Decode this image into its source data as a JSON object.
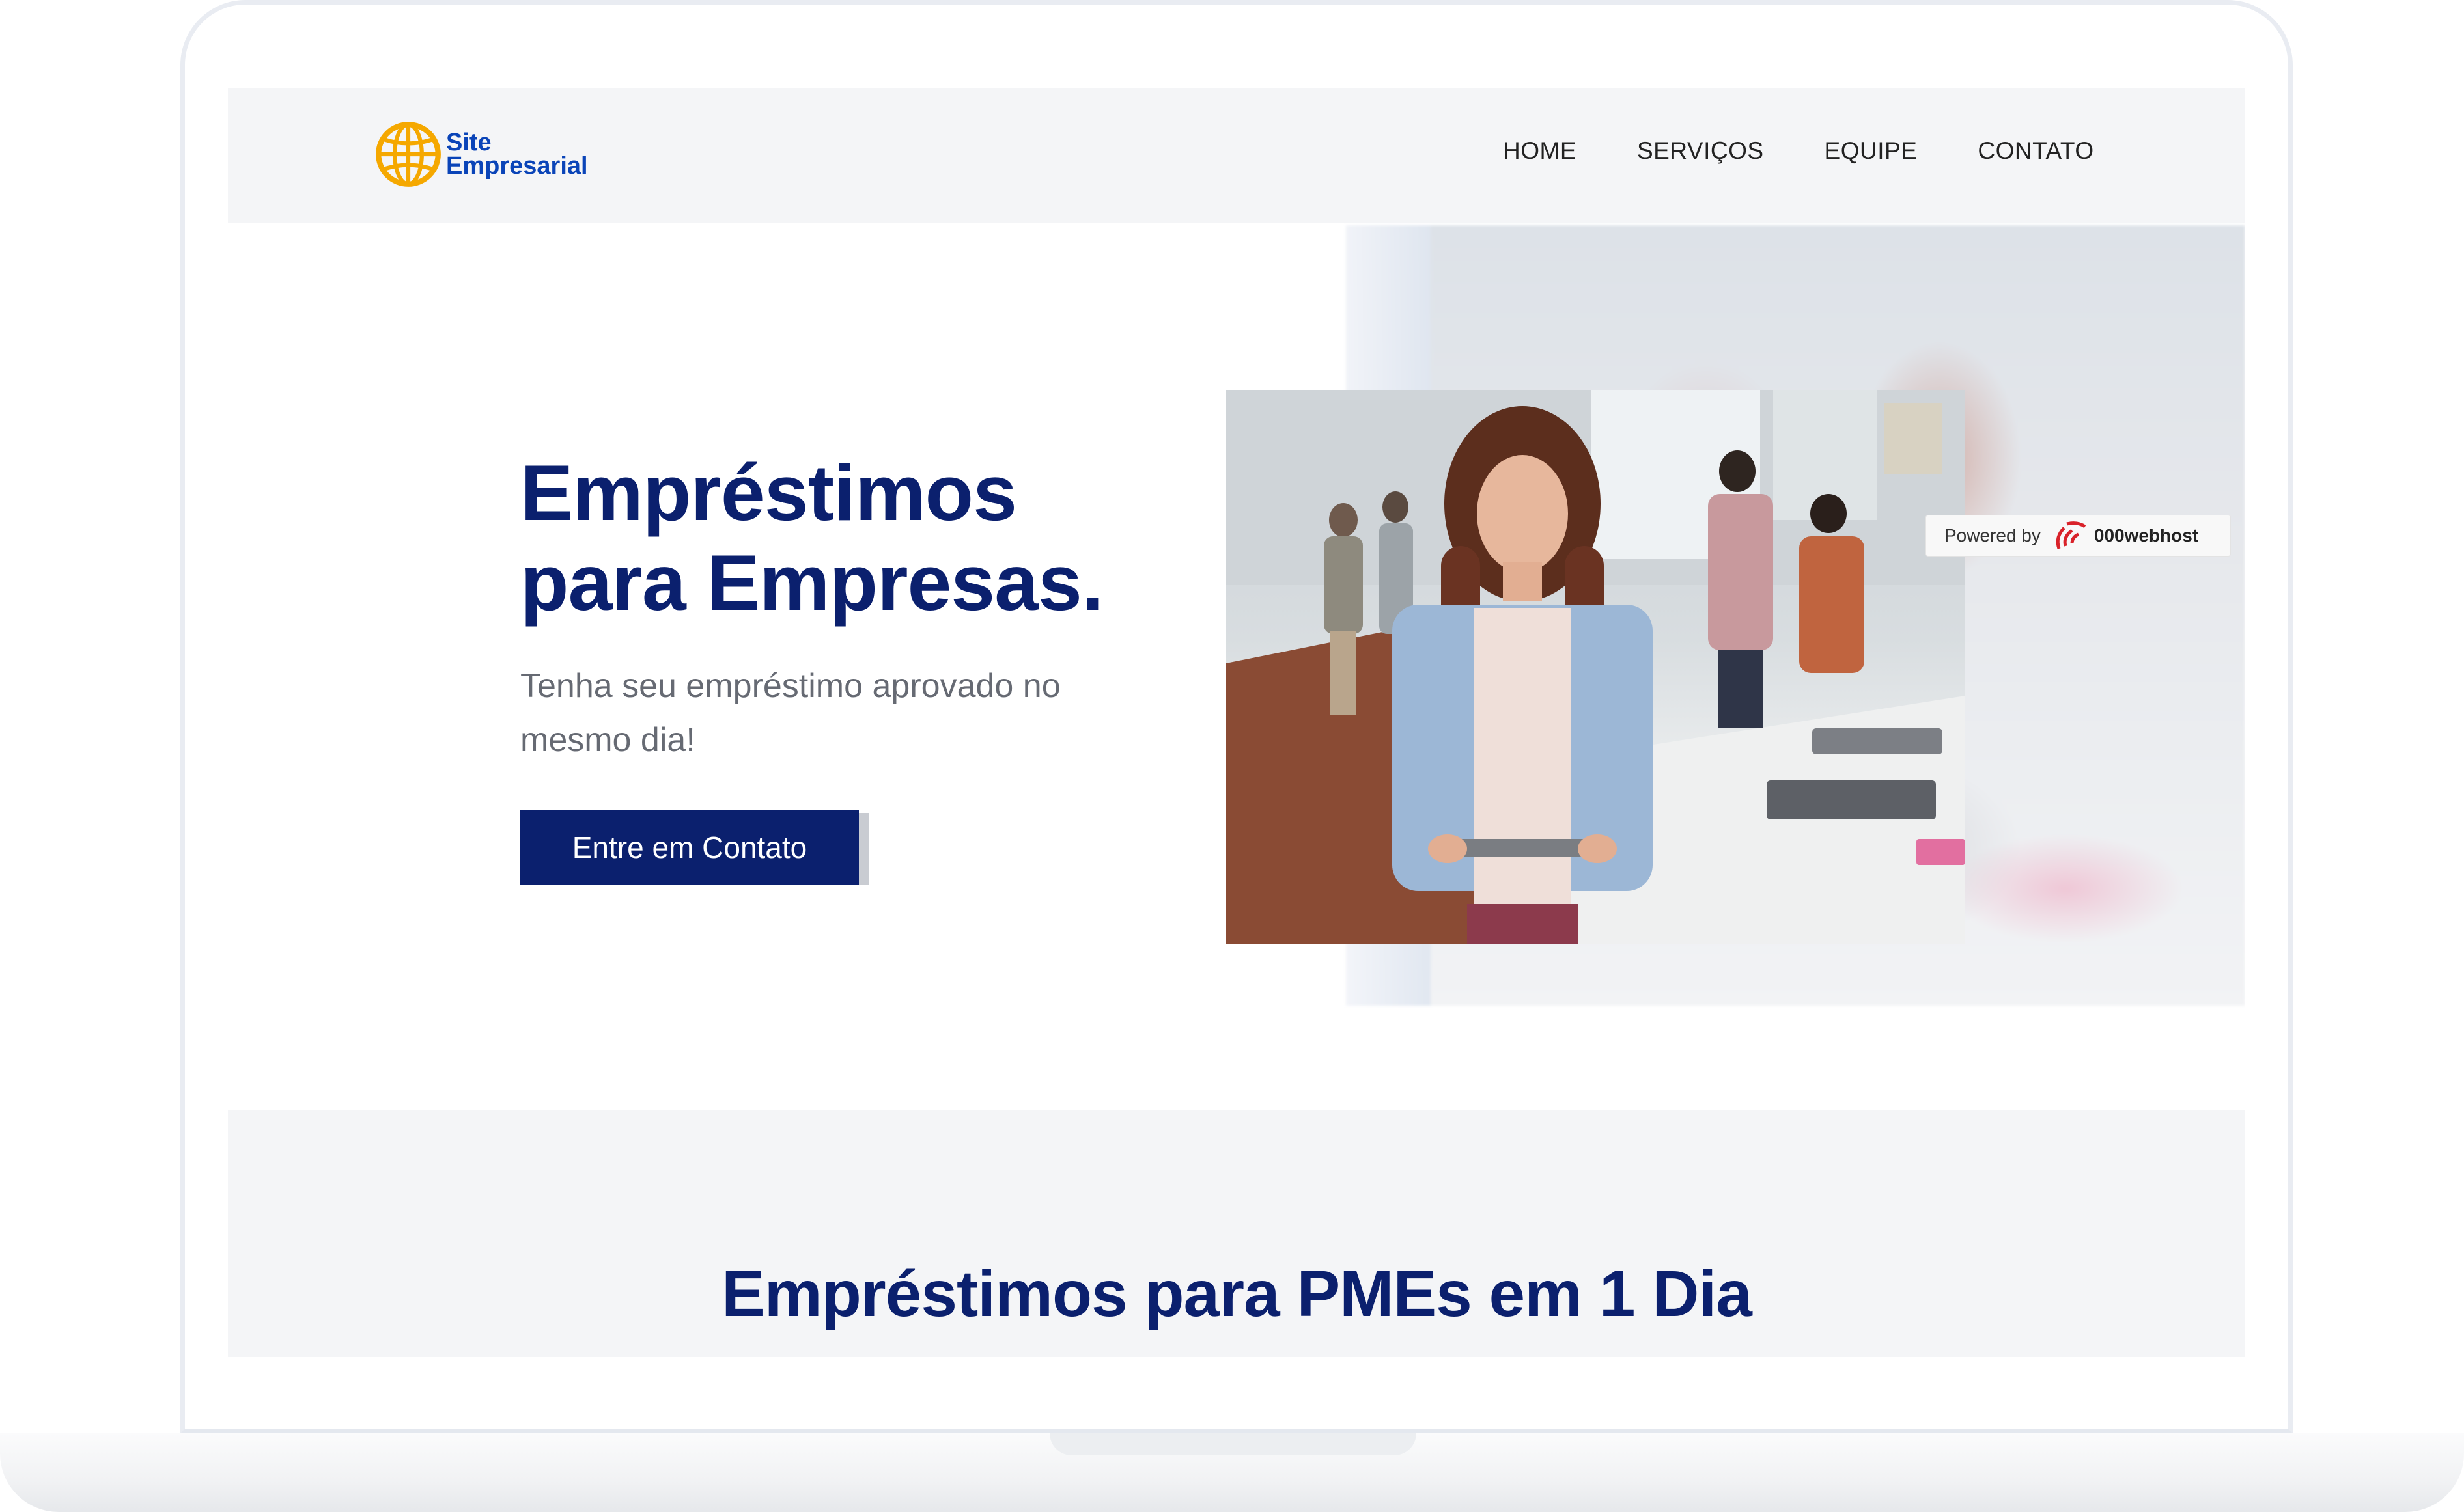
{
  "logo": {
    "line1": "Site",
    "line2": "Empresarial"
  },
  "nav": {
    "items": [
      {
        "label": "HOME"
      },
      {
        "label": "SERVIÇOS"
      },
      {
        "label": "EQUIPE"
      },
      {
        "label": "CONTATO"
      }
    ]
  },
  "hero": {
    "title_line1": "Empréstimos",
    "title_line2": "para Empresas.",
    "subtitle_line1": "Tenha seu empréstimo aprovado no",
    "subtitle_line2": "mesmo dia!",
    "cta_label": "Entre em Contato"
  },
  "badge": {
    "prefix": "Powered by",
    "brand": "000webhost"
  },
  "section2": {
    "title": "Empréstimos para PMEs em 1 Dia"
  },
  "colors": {
    "primary": "#0b206e",
    "logo_blue": "#0a44b8",
    "globe": "#f5a800",
    "nav_bg": "#f4f5f7",
    "badge_red": "#d9222a"
  },
  "icons": {
    "logo": "globe-icon",
    "badge": "000webhost-logo-icon"
  }
}
